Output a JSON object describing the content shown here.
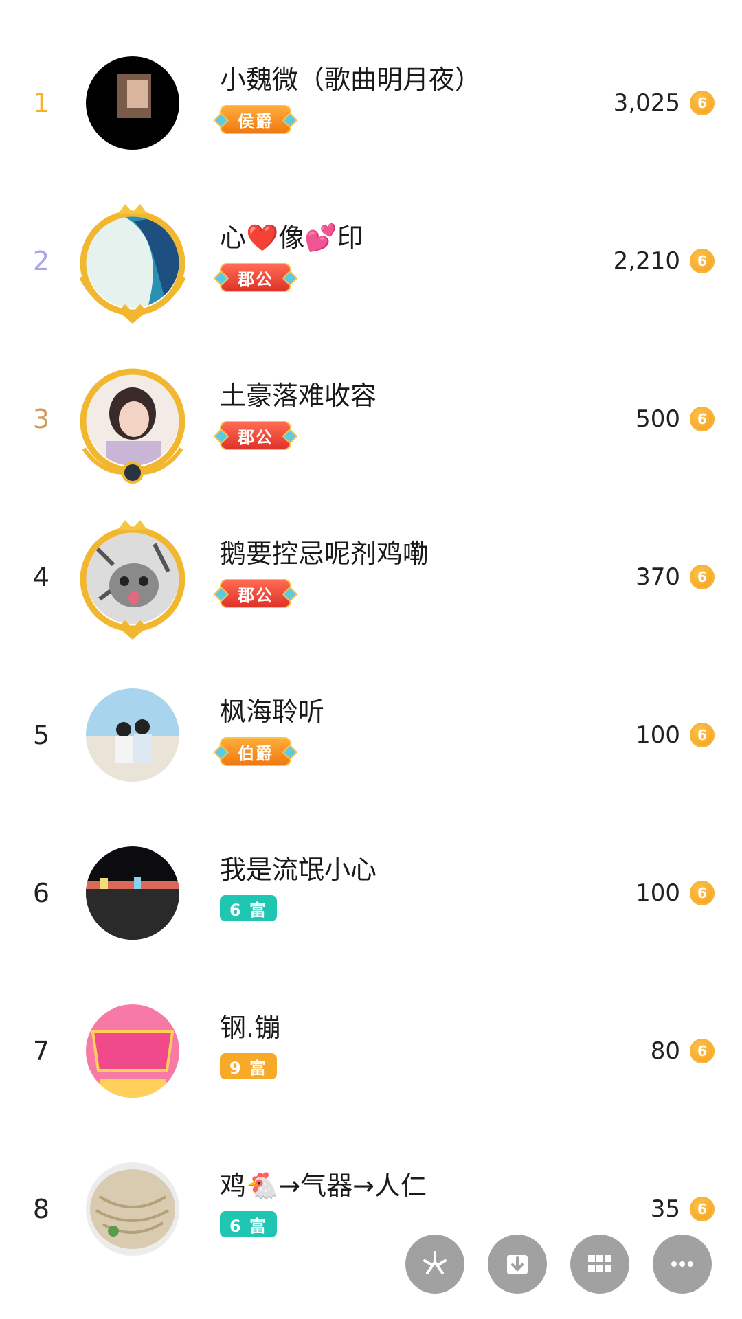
{
  "rows": [
    {
      "rank": "1",
      "name": "小魏微（歌曲明月夜）",
      "badge": "侯爵",
      "score": "3,025"
    },
    {
      "rank": "2",
      "name": "心❤️像💕印",
      "badge": "郡公",
      "score": "2,210"
    },
    {
      "rank": "3",
      "name": "土豪落难收容",
      "badge": "郡公",
      "score": "500"
    },
    {
      "rank": "4",
      "name": "鹅要控忌呢剂鸡嘞",
      "badge": "郡公",
      "score": "370"
    },
    {
      "rank": "5",
      "name": "枫海聆听",
      "badge": "伯爵",
      "score": "100"
    },
    {
      "rank": "6",
      "name": "我是流氓小心",
      "badge": "6 富",
      "score": "100"
    },
    {
      "rank": "7",
      "name": "钢.镚",
      "badge": "9 富",
      "score": "80"
    },
    {
      "rank": "8",
      "name": "鸡🐔→气器→人仁",
      "badge": "6 富",
      "score": "35"
    }
  ],
  "coin_symbol": "6",
  "rank_colors": {
    "1": "#f2b32a",
    "2": "#a9a6e6",
    "3": "#d19a5a"
  },
  "fab_icons": [
    "share-icon",
    "download-icon",
    "grid-icon",
    "more-icon"
  ]
}
